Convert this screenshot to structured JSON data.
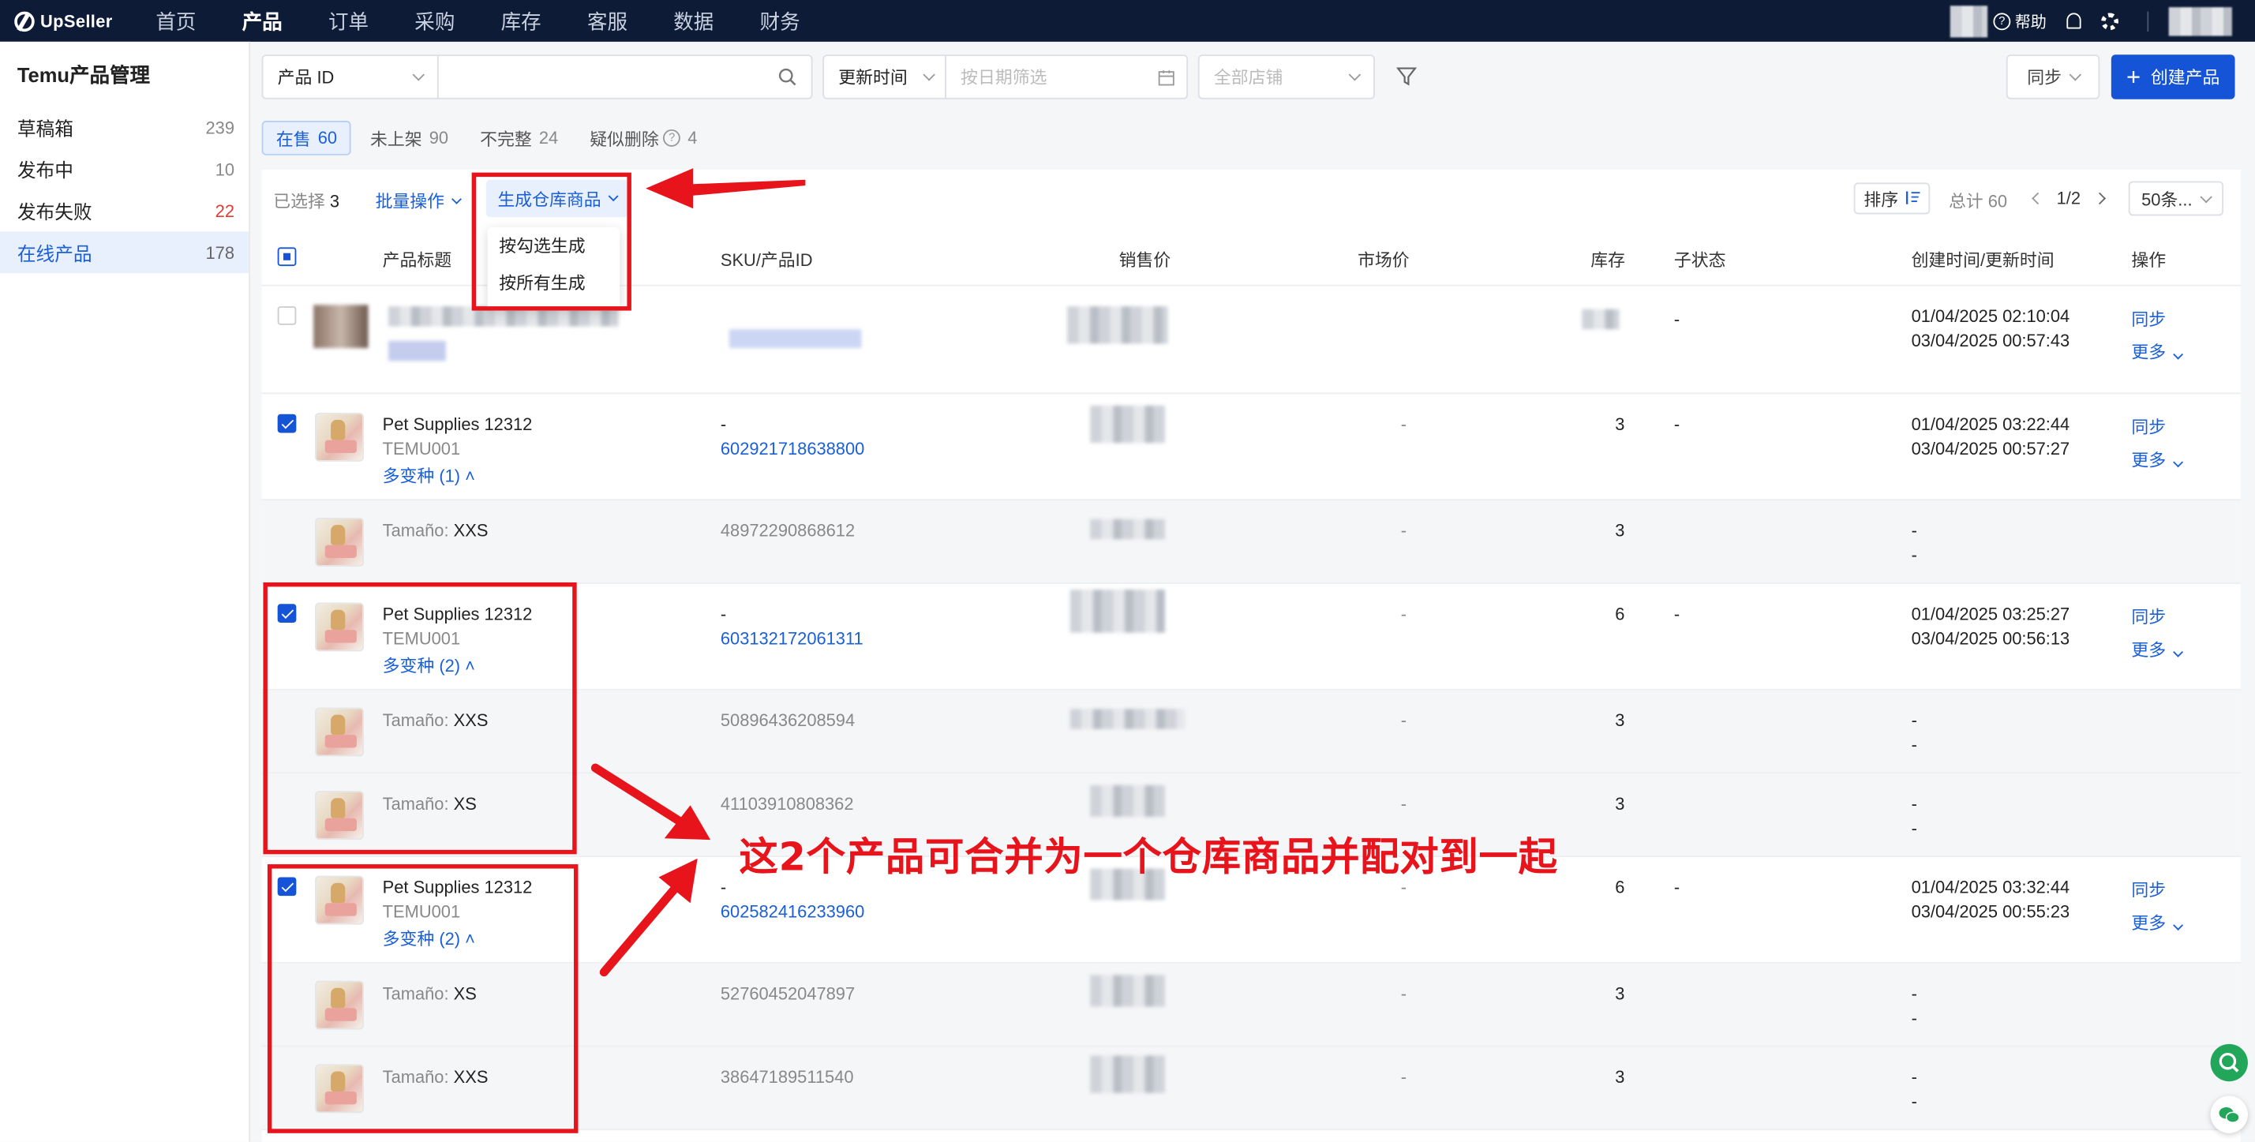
{
  "app": {
    "logo_text": "UpSeller"
  },
  "nav": {
    "items": [
      "首页",
      "产品",
      "订单",
      "采购",
      "库存",
      "客服",
      "数据",
      "财务"
    ],
    "active": "产品"
  },
  "topbar": {
    "help_label": "帮助"
  },
  "sidebar": {
    "title": "Temu产品管理",
    "items": [
      {
        "label": "草稿箱",
        "count": "239"
      },
      {
        "label": "发布中",
        "count": "10"
      },
      {
        "label": "发布失败",
        "count": "22"
      },
      {
        "label": "在线产品",
        "count": "178"
      }
    ]
  },
  "filters": {
    "search_field": "产品 ID",
    "search_placeholder": "",
    "time_field": "更新时间",
    "date_placeholder": "按日期筛选",
    "store_placeholder": "全部店铺",
    "sync_label": "同步",
    "create_label": "创建产品"
  },
  "tabs": [
    {
      "label": "在售",
      "count": "60"
    },
    {
      "label": "未上架",
      "count": "90"
    },
    {
      "label": "不完整",
      "count": "24"
    },
    {
      "label": "疑似删除",
      "count": "4"
    }
  ],
  "toolbar": {
    "selected_label": "已选择",
    "selected_count": "3",
    "batch_label": "批量操作",
    "generate_label": "生成仓库商品",
    "sort_label": "排序",
    "total_label": "总计 60",
    "page": "1/2",
    "per_page": "50条..."
  },
  "dropdown": {
    "items": [
      "按勾选生成",
      "按所有生成"
    ]
  },
  "columns": {
    "title": "产品标题",
    "sku": "SKU/产品ID",
    "price": "销售价",
    "market": "市场价",
    "stock": "库存",
    "substatus": "子状态",
    "time": "创建时间/更新时间",
    "action": "操作"
  },
  "rows": [
    {
      "type": "product",
      "checked": false,
      "title": "",
      "sub": "",
      "variants": "",
      "sku_top": "",
      "sku": "",
      "market": "",
      "stock": "",
      "substatus": "-",
      "created": "01/04/2025 02:10:04",
      "updated": "03/04/2025 00:57:43",
      "action1": "同步",
      "action2": "更多"
    },
    {
      "type": "product",
      "checked": true,
      "title": "Pet Supplies 12312",
      "sub": "TEMU001",
      "variants": "多变种 (1)",
      "sku_top": "-",
      "sku": "602921718638800",
      "market": "-",
      "stock": "3",
      "substatus": "-",
      "created": "01/04/2025 03:22:44",
      "updated": "03/04/2025 00:57:27",
      "action1": "同步",
      "action2": "更多"
    },
    {
      "type": "variant",
      "label": "Tamaño:",
      "value": "XXS",
      "sku": "48972290868612",
      "market": "-",
      "stock": "3",
      "created": "-",
      "updated": "-"
    },
    {
      "type": "product",
      "checked": true,
      "title": "Pet Supplies 12312",
      "sub": "TEMU001",
      "variants": "多变种 (2)",
      "sku_top": "-",
      "sku": "603132172061311",
      "market": "-",
      "stock": "6",
      "substatus": "-",
      "created": "01/04/2025 03:25:27",
      "updated": "03/04/2025 00:56:13",
      "action1": "同步",
      "action2": "更多"
    },
    {
      "type": "variant",
      "label": "Tamaño:",
      "value": "XXS",
      "sku": "50896436208594",
      "market": "-",
      "stock": "3",
      "created": "-",
      "updated": "-"
    },
    {
      "type": "variant",
      "label": "Tamaño:",
      "value": "XS",
      "sku": "41103910808362",
      "market": "-",
      "stock": "3",
      "created": "-",
      "updated": "-"
    },
    {
      "type": "product",
      "checked": true,
      "title": "Pet Supplies 12312",
      "sub": "TEMU001",
      "variants": "多变种 (2)",
      "sku_top": "-",
      "sku": "602582416233960",
      "market": "-",
      "stock": "6",
      "substatus": "-",
      "created": "01/04/2025 03:32:44",
      "updated": "03/04/2025 00:55:23",
      "action1": "同步",
      "action2": "更多"
    },
    {
      "type": "variant",
      "label": "Tamaño:",
      "value": "XS",
      "sku": "52760452047897",
      "market": "-",
      "stock": "3",
      "created": "-",
      "updated": "-"
    },
    {
      "type": "variant",
      "label": "Tamaño:",
      "value": "XXS",
      "sku": "38647189511540",
      "market": "-",
      "stock": "3",
      "created": "-",
      "updated": "-"
    }
  ],
  "annotation": {
    "text": "这2个产品可合并为一个仓库商品并配对到一起",
    "color": "#e8141c"
  },
  "colors": {
    "primary": "#1554d6",
    "topbar": "#0d1b36",
    "accent_red": "#e8141c"
  }
}
